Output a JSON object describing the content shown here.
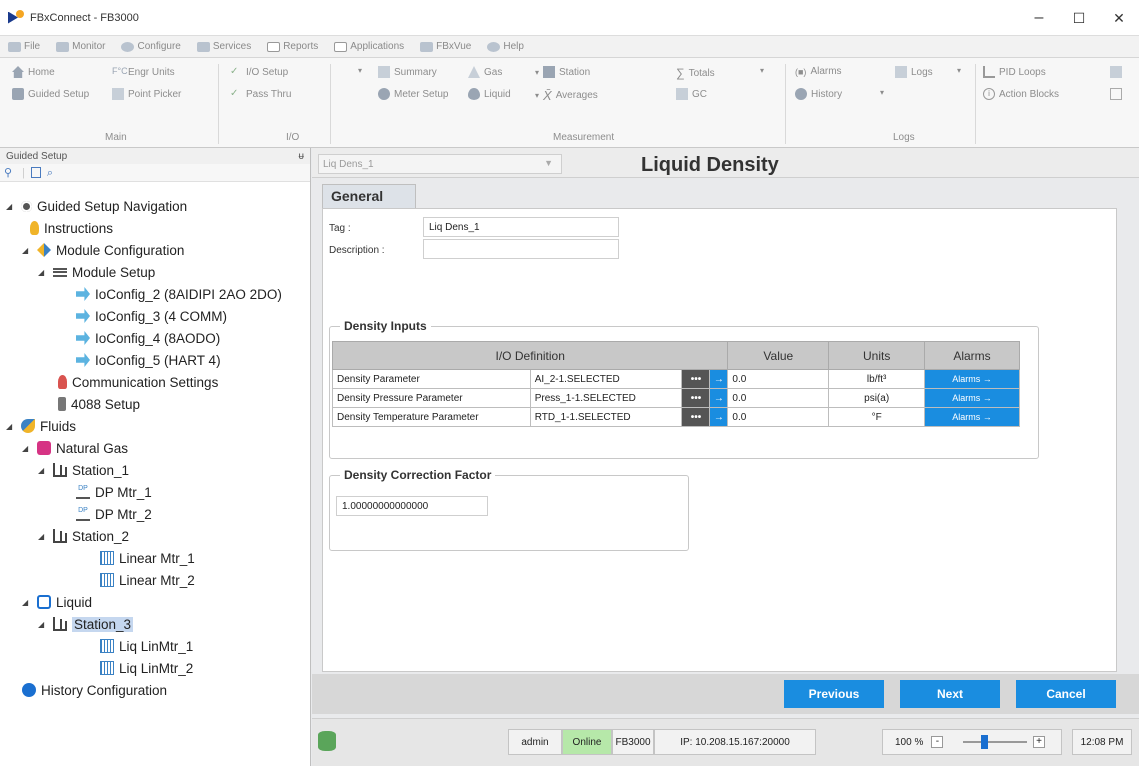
{
  "window": {
    "title": "FBxConnect - FB3000",
    "minimize": "–",
    "maximize": "☐",
    "close": "✕"
  },
  "menu": [
    {
      "label": "File"
    },
    {
      "label": "Monitor"
    },
    {
      "label": "Configure"
    },
    {
      "label": "Services"
    },
    {
      "label": "Reports"
    },
    {
      "label": "Applications"
    },
    {
      "label": "FBxVue"
    },
    {
      "label": "Help"
    }
  ],
  "ribbon": {
    "home": "Home",
    "guided_setup": "Guided Setup",
    "engr_units": "Engr Units",
    "point_picker": "Point Picker",
    "io_setup": "I/O Setup",
    "pass_thru": "Pass Thru",
    "summary": "Summary",
    "meter_setup": "Meter Setup",
    "gas": "Gas",
    "liquid": "Liquid",
    "station": "Station",
    "averages": "Averages",
    "totals": "Totals",
    "gc": "GC",
    "alarms": "Alarms",
    "history": "History",
    "logs": "Logs",
    "pid_loops": "PID Loops",
    "action_blocks": "Action Blocks",
    "group_main": "Main",
    "group_io": "I/O",
    "group_measurement": "Measurement",
    "group_logs": "Logs"
  },
  "left_panel": {
    "header": "Guided Setup",
    "pin": "ᵾ",
    "tree": [
      {
        "label": "Guided Setup Navigation",
        "icon": "gear-icon"
      },
      {
        "label": "Instructions",
        "icon": "bulb-icon"
      },
      {
        "label": "Module Configuration",
        "icon": "module-icon"
      },
      {
        "label": "Module Setup",
        "icon": "setup-icon"
      },
      {
        "label": "IoConfig_2 (8AIDIPI 2AO 2DO)",
        "icon": "io-icon"
      },
      {
        "label": "IoConfig_3 (4 COMM)",
        "icon": "io-icon"
      },
      {
        "label": "IoConfig_4 (8AODO)",
        "icon": "io-icon"
      },
      {
        "label": "IoConfig_5 (HART 4)",
        "icon": "io-icon"
      },
      {
        "label": "Communication Settings",
        "icon": "comm-icon"
      },
      {
        "label": "4088 Setup",
        "icon": "transmitter-icon"
      },
      {
        "label": "Fluids",
        "icon": "fluids-icon"
      },
      {
        "label": "Natural Gas",
        "icon": "gas-icon"
      },
      {
        "label": "Station_1",
        "icon": "station-icon"
      },
      {
        "label": "DP Mtr_1",
        "icon": "dp-meter-icon"
      },
      {
        "label": "DP Mtr_2",
        "icon": "dp-meter-icon"
      },
      {
        "label": "Station_2",
        "icon": "station-icon"
      },
      {
        "label": "Linear Mtr_1",
        "icon": "linear-meter-icon"
      },
      {
        "label": "Linear Mtr_2",
        "icon": "linear-meter-icon"
      },
      {
        "label": "Liquid",
        "icon": "liquid-icon"
      },
      {
        "label": "Station_3",
        "icon": "station-icon"
      },
      {
        "label": "Liq LinMtr_1",
        "icon": "linear-meter-icon"
      },
      {
        "label": "Liq LinMtr_2",
        "icon": "linear-meter-icon"
      },
      {
        "label": "History Configuration",
        "icon": "history-icon"
      }
    ]
  },
  "main": {
    "selector_value": "Liq Dens_1",
    "title": "Liquid Density",
    "tab": "General",
    "tag_label": "Tag :",
    "tag_value": "Liq Dens_1",
    "desc_label": "Description :",
    "desc_value": "",
    "density_inputs_title": "Density Inputs",
    "columns": {
      "io": "I/O Definition",
      "value": "Value",
      "units": "Units",
      "alarms": "Alarms"
    },
    "rows": [
      {
        "name": "Density Parameter",
        "io": "AI_2-1.SELECTED",
        "value": "0.0",
        "units": "lb/ft³",
        "alarms": "Alarms →"
      },
      {
        "name": "Density Pressure Parameter",
        "io": "Press_1-1.SELECTED",
        "value": "0.0",
        "units": "psi(a)",
        "alarms": "Alarms →"
      },
      {
        "name": "Density Temperature Parameter",
        "io": "RTD_1-1.SELECTED",
        "value": "0.0",
        "units": "°F",
        "alarms": "Alarms →"
      }
    ],
    "correction_title": "Density Correction Factor",
    "correction_value": "1.00000000000000"
  },
  "buttons": {
    "previous": "Previous",
    "next": "Next",
    "cancel": "Cancel"
  },
  "status": {
    "user": "admin",
    "online": "Online",
    "device": "FB3000",
    "ip": "IP: 10.208.15.167:20000",
    "zoom": "100 %",
    "zoom_minus": "-",
    "zoom_plus": "+",
    "time": "12:08 PM"
  },
  "colors": {
    "accent": "#1a8de0",
    "online": "#b6e8a9",
    "selection": "#c5d7ef"
  }
}
